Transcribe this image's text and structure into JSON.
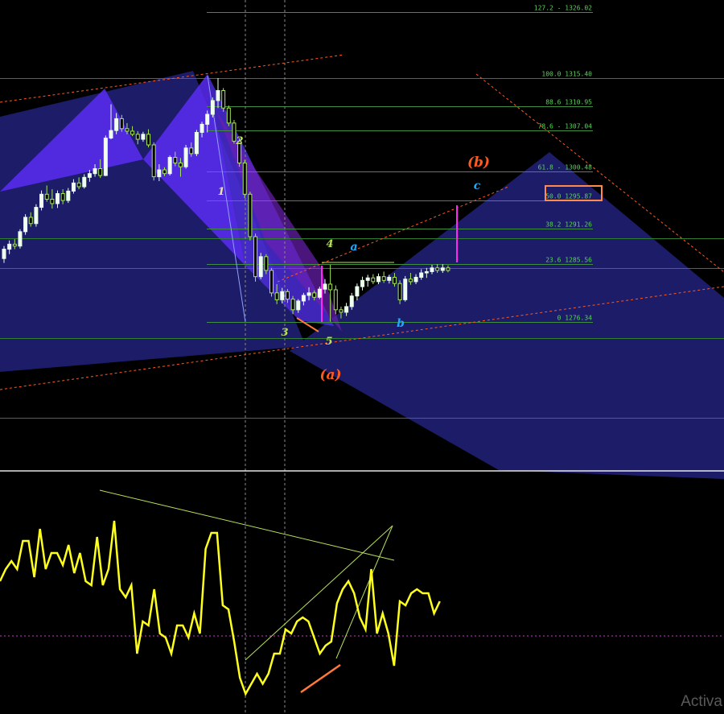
{
  "watermark": "Activa",
  "chart_data": [
    {
      "type": "candlestick",
      "panel": "price",
      "fib_levels": [
        {
          "label": "127.2 - 1326.02",
          "ratio": 127.2,
          "price": 1326.02
        },
        {
          "label": "100.0 1315.40",
          "ratio": 100.0,
          "price": 1315.4
        },
        {
          "label": "88.6 1310.95",
          "ratio": 88.6,
          "price": 1310.95
        },
        {
          "label": "78.6 - 1307.04",
          "ratio": 78.6,
          "price": 1307.04
        },
        {
          "label": "61.8 - 1300.48",
          "ratio": 61.8,
          "price": 1300.48
        },
        {
          "label": "50.0 1295.87",
          "ratio": 50.0,
          "price": 1295.87,
          "highlighted": true
        },
        {
          "label": "38.2 1291.26",
          "ratio": 38.2,
          "price": 1291.26
        },
        {
          "label": "23.6 1285.56",
          "ratio": 23.6,
          "price": 1285.56
        },
        {
          "label": "0 1276.34",
          "ratio": 0,
          "price": 1276.34
        }
      ],
      "wave_labels": [
        {
          "text": "1",
          "color": "#e8e8a0"
        },
        {
          "text": "2",
          "color": "#b6e05a"
        },
        {
          "text": "3",
          "color": "#b6e05a"
        },
        {
          "text": "4",
          "color": "#b6e05a"
        },
        {
          "text": "5",
          "color": "#b6e05a"
        },
        {
          "text": "(a)",
          "color": "#ff5a1e"
        },
        {
          "text": "(b)",
          "color": "#ff5a1e"
        },
        {
          "text": "a",
          "color": "#1eaaff"
        },
        {
          "text": "b",
          "color": "#1eaaff"
        },
        {
          "text": "c",
          "color": "#1eaaff"
        }
      ],
      "candles": [
        [
          1286.5,
          1288.5,
          1285.8,
          1288.0
        ],
        [
          1288.0,
          1289.4,
          1287.2,
          1288.8
        ],
        [
          1288.8,
          1289.6,
          1288.0,
          1288.5
        ],
        [
          1288.5,
          1291.2,
          1288.1,
          1290.8
        ],
        [
          1290.8,
          1293.6,
          1290.3,
          1293.1
        ],
        [
          1293.1,
          1293.9,
          1291.6,
          1292.1
        ],
        [
          1292.1,
          1295.2,
          1291.6,
          1294.7
        ],
        [
          1294.7,
          1297.4,
          1294.2,
          1296.8
        ],
        [
          1296.8,
          1298.2,
          1295.6,
          1296.0
        ],
        [
          1296.0,
          1297.6,
          1294.5,
          1295.3
        ],
        [
          1295.3,
          1297.4,
          1294.6,
          1296.9
        ],
        [
          1296.9,
          1297.6,
          1295.2,
          1295.8
        ],
        [
          1295.8,
          1297.8,
          1295.4,
          1297.3
        ],
        [
          1297.3,
          1299.2,
          1296.9,
          1298.6
        ],
        [
          1298.6,
          1299.5,
          1297.6,
          1298.0
        ],
        [
          1298.0,
          1300.0,
          1297.7,
          1299.5
        ],
        [
          1299.5,
          1300.7,
          1298.8,
          1300.1
        ],
        [
          1300.1,
          1301.6,
          1299.6,
          1300.9
        ],
        [
          1300.9,
          1302.4,
          1299.4,
          1299.8
        ],
        [
          1299.8,
          1306.2,
          1299.7,
          1305.8
        ],
        [
          1305.8,
          1311.2,
          1305.6,
          1307.0
        ],
        [
          1307.0,
          1309.8,
          1306.4,
          1308.9
        ],
        [
          1308.9,
          1309.5,
          1306.8,
          1307.3
        ],
        [
          1307.3,
          1308.2,
          1306.4,
          1306.9
        ],
        [
          1306.9,
          1307.7,
          1306.1,
          1306.4
        ],
        [
          1306.4,
          1306.9,
          1304.8,
          1305.6
        ],
        [
          1305.6,
          1306.8,
          1305.2,
          1306.4
        ],
        [
          1306.4,
          1307.2,
          1304.3,
          1304.7
        ],
        [
          1304.7,
          1305.1,
          1299.0,
          1299.6
        ],
        [
          1299.6,
          1301.6,
          1298.9,
          1300.7
        ],
        [
          1300.7,
          1301.1,
          1299.7,
          1300.1
        ],
        [
          1300.1,
          1303.0,
          1299.8,
          1302.7
        ],
        [
          1302.7,
          1303.6,
          1301.3,
          1301.8
        ],
        [
          1301.8,
          1302.6,
          1299.6,
          1301.2
        ],
        [
          1301.2,
          1304.7,
          1300.9,
          1304.2
        ],
        [
          1304.2,
          1305.1,
          1302.8,
          1303.3
        ],
        [
          1303.3,
          1307.1,
          1302.9,
          1306.7
        ],
        [
          1306.7,
          1308.4,
          1305.9,
          1308.0
        ],
        [
          1308.0,
          1310.2,
          1306.7,
          1309.6
        ],
        [
          1309.6,
          1312.3,
          1309.1,
          1311.8
        ],
        [
          1311.8,
          1315.4,
          1310.6,
          1313.4
        ],
        [
          1313.4,
          1313.8,
          1310.0,
          1310.6
        ],
        [
          1310.6,
          1311.0,
          1307.7,
          1308.2
        ],
        [
          1308.2,
          1308.7,
          1304.9,
          1305.3
        ],
        [
          1305.3,
          1305.8,
          1301.2,
          1301.8
        ],
        [
          1301.8,
          1302.3,
          1296.2,
          1296.8
        ],
        [
          1296.8,
          1297.2,
          1289.4,
          1290.0
        ],
        [
          1290.0,
          1290.5,
          1282.8,
          1283.6
        ],
        [
          1283.6,
          1287.4,
          1283.2,
          1286.8
        ],
        [
          1286.8,
          1287.2,
          1284.0,
          1284.6
        ],
        [
          1284.6,
          1285.0,
          1280.4,
          1281.0
        ],
        [
          1281.0,
          1282.4,
          1279.2,
          1279.9
        ],
        [
          1279.9,
          1281.8,
          1279.3,
          1281.2
        ],
        [
          1281.2,
          1281.6,
          1279.4,
          1280.0
        ],
        [
          1280.0,
          1280.5,
          1277.6,
          1278.3
        ],
        [
          1278.3,
          1280.0,
          1277.8,
          1279.7
        ],
        [
          1279.7,
          1281.0,
          1279.0,
          1280.6
        ],
        [
          1280.6,
          1281.9,
          1279.8,
          1281.0
        ],
        [
          1281.0,
          1281.4,
          1279.8,
          1280.3
        ],
        [
          1280.3,
          1282.0,
          1280.0,
          1281.6
        ],
        [
          1281.6,
          1283.2,
          1280.9,
          1282.4
        ],
        [
          1282.4,
          1285.5,
          1276.4,
          1281.5
        ],
        [
          1281.5,
          1282.2,
          1277.6,
          1278.3
        ],
        [
          1278.3,
          1278.8,
          1276.9,
          1277.9
        ],
        [
          1277.9,
          1279.4,
          1277.3,
          1278.8
        ],
        [
          1278.8,
          1281.0,
          1278.3,
          1280.5
        ],
        [
          1280.5,
          1282.5,
          1279.8,
          1282.0
        ],
        [
          1282.0,
          1283.6,
          1281.4,
          1283.0
        ],
        [
          1283.0,
          1283.9,
          1282.0,
          1283.4
        ],
        [
          1283.4,
          1284.0,
          1282.4,
          1282.8
        ],
        [
          1282.8,
          1284.1,
          1282.4,
          1283.6
        ],
        [
          1283.6,
          1284.4,
          1282.6,
          1283.0
        ],
        [
          1283.0,
          1283.9,
          1282.5,
          1283.5
        ],
        [
          1283.5,
          1284.2,
          1282.0,
          1282.5
        ],
        [
          1282.5,
          1283.0,
          1279.2,
          1279.9
        ],
        [
          1279.9,
          1283.7,
          1279.6,
          1283.2
        ],
        [
          1283.2,
          1284.2,
          1282.3,
          1282.8
        ],
        [
          1282.8,
          1284.0,
          1282.4,
          1283.5
        ],
        [
          1283.5,
          1284.8,
          1283.1,
          1284.2
        ],
        [
          1284.2,
          1285.0,
          1283.4,
          1284.4
        ],
        [
          1284.4,
          1285.5,
          1284.0,
          1285.0
        ],
        [
          1285.0,
          1285.6,
          1284.2,
          1284.6
        ],
        [
          1284.6,
          1285.6,
          1284.2,
          1285.0
        ],
        [
          1285.0,
          1285.4,
          1284.3,
          1284.6
        ]
      ]
    },
    {
      "type": "line",
      "panel": "oscillator",
      "values": [
        56,
        62,
        66,
        62,
        76,
        76,
        58,
        82,
        62,
        70,
        70,
        64,
        74,
        60,
        70,
        56,
        54,
        78,
        54,
        62,
        86,
        52,
        48,
        54,
        20,
        36,
        34,
        52,
        30,
        28,
        20,
        34,
        34,
        28,
        40,
        30,
        72,
        80,
        80,
        44,
        42,
        26,
        8,
        0,
        5,
        10,
        5,
        10,
        20,
        20,
        32,
        30,
        36,
        38,
        36,
        28,
        20,
        24,
        26,
        45,
        52,
        56,
        50,
        38,
        32,
        62,
        30,
        40,
        30,
        14,
        46,
        44,
        50,
        52,
        50,
        50,
        40,
        46
      ]
    }
  ]
}
